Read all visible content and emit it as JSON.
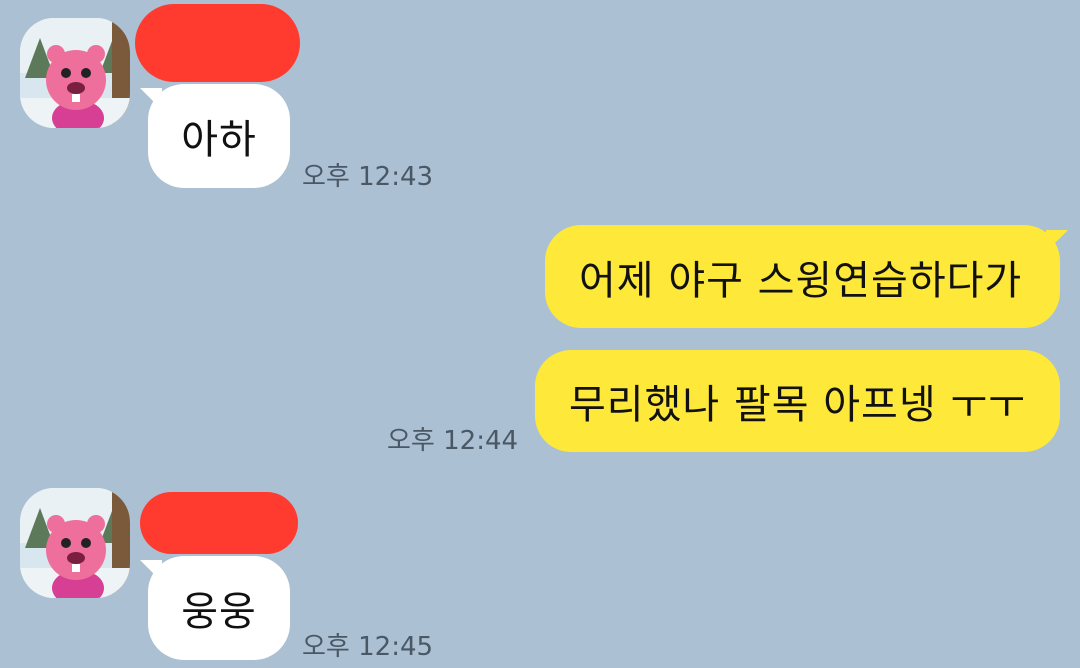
{
  "chat": {
    "messages": [
      {
        "sender": "other",
        "text": "아하",
        "time": "오후 12:43"
      },
      {
        "sender": "me",
        "text": "어제 야구 스윙연습하다가"
      },
      {
        "sender": "me",
        "text": "무리했나 팔목 아프넹 ㅜㅜ",
        "time": "오후 12:44"
      },
      {
        "sender": "other",
        "text": "웅웅",
        "time": "오후 12:45"
      }
    ]
  },
  "colors": {
    "background": "#abc0d3",
    "incoming_bubble": "#ffffff",
    "outgoing_bubble": "#fee83a",
    "redaction": "#ff3b30",
    "timestamp": "#4a5866"
  },
  "icons": {
    "avatar": "pink-beaver-character-avatar-icon"
  }
}
